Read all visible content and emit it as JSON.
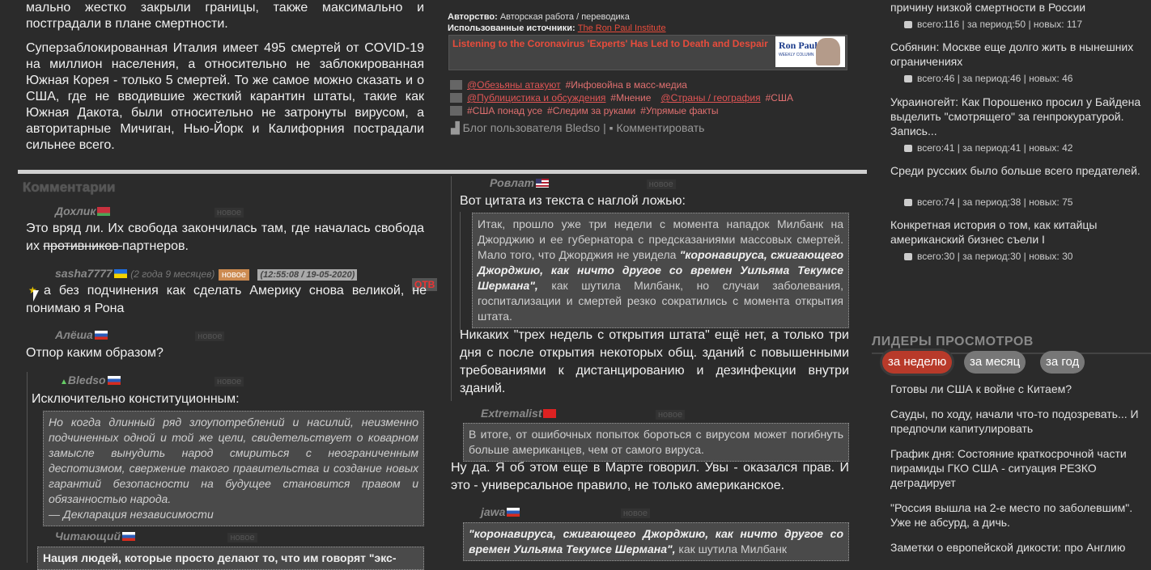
{
  "article": {
    "p1": "мально жестко закрыли границы, также максимально и постградали в плане смертности.",
    "p2": "Суперзаблокированная Италия имеет 495 смертей от COVID-19 на миллион населения, а относительно не заблокированная Южная Корея - только 5 смертей. То же самое можно сказать и о США, где не вводившие жесткий карантин штаты, такие как Южная Дакота, были относительно не затронуты вирусом, а авторитарные Мичиган, Нью-Йорк и Калифорния пострадали сильнее всего."
  },
  "meta": {
    "author_label": "Авторство:",
    "author_value": "Авторская работа / переводика",
    "sources_label": "Использованные источники:",
    "sources_value": "The Ron Paul Institute",
    "card_title": "Listening to the Coronavirus 'Experts' Has Led to Death and Despair",
    "card_thumb_name": "Ron Paul",
    "card_thumb_sub": "WEEKLY COLUMN"
  },
  "tags": {
    "r1a": "@Обезьяны атакуют",
    "r1b": "#Инфовойна в масс-медиа",
    "r2a": "@Публицистика и обсуждения",
    "r2b": "#Мнение",
    "r2c": "@Страны / география",
    "r2d": "#США",
    "r3a": "#США понад усе",
    "r3b": "#Следим за руками",
    "r3c": "#Упрямые факты"
  },
  "bloglinks": {
    "blog": "Блог пользователя Bledso",
    "sep": "|",
    "comment": "Комментировать"
  },
  "comments_title": "Комментарии",
  "new_label": "новое",
  "left_comments": {
    "c1_user": "Дохлик",
    "c1_text_a": "Это вряд ли. Их свобода закончилась там, где началась свобода их ",
    "c1_text_strike": "противников ",
    "c1_text_b": "партнеров.",
    "c2_user": "sasha7777",
    "c2_ago": "(2 года 9 месяцев)",
    "c2_time": "(12:55:08 / 19-05-2020)",
    "c2_otv": "ОТВ",
    "c2_text": "а без подчинения как сделать Америку снова великой, не понимаю я Рона",
    "c3_user": "Алёша",
    "c3_text": "Отпор каким образом?",
    "c4_user": "Bledso",
    "c4_text": "Исключительно конституционным:",
    "c4_quote": "Но когда длинный ряд злоупотреблений и насилий, неизменно подчиненных одной и той же цели, свидетельствует о коварном замысле вынудить народ смириться с неограниченным деспотизмом, свержение такого правительства и создание новых гарантий безопасности на будущее становится правом и обязанностью народа.",
    "c4_quote_src": "— Декларация независимости",
    "c5_user": "Читающий",
    "c5_quote": "Нация людей, которые просто делают то, что им говорят \"экс-"
  },
  "right_comments": {
    "c1_user": "Ровлат",
    "c1_text": "Вот цитата из текста с наглой ложью:",
    "c1_quote_a": "Итак, прошло уже три недели с момента нападок Милбанк на Джорджию и ее губернатора с предсказаниями массовых смертей. Мало того, что Джорджия не увидела ",
    "c1_quote_b": "\"коронавируса, сжигающего Джорджию, как ничто другое со времен Уильяма Текумсе Шермана\",",
    "c1_quote_c": " как шутила Милбанк, но случаи заболевания, госпитализации и смертей резко сократились с момента открытия штата.",
    "c1_text2": "Никаких \"трех недель с открытия штата\" ещё нет, а только три дня с после открытия некоторых общ. зданий с повышенными требованиями к дистанцированию и дезинфекции внутри зданий.",
    "c2_user": "Extremalist",
    "c2_quote": "В итоге, от ошибочных попыток бороться с вирусом может погибнуть больше американцев, чем от самого вируса.",
    "c2_text": "Ну да. Я об этом еще в Марте говорил. Увы - оказался прав. И это - универсальное правило, не только американское.",
    "c3_user": "jawa",
    "c3_quote_b": "\"коронавируса, сжигающего Джорджию, как ничто другое со времен Уильяма Текумсе Шермана\",",
    "c3_quote_c": " как шутила Милбанк"
  },
  "sidebar": {
    "i0": "причину низкой смертности в России",
    "i0_stats": "всего:116 | за период:50 | новых: 117",
    "i1": "Собянин: Москве еще долго жить в нынешних ограничениях",
    "i1_stats": "всего:46 | за период:46 | новых: 46",
    "i2": "Украиногейт: Как Порошенко просил у Байдена выделить \"смотрящего\" за генпрокуратурой. Запись...",
    "i2_stats": "всего:41 | за период:41 | новых: 42",
    "i3": "Среди русских было больше всего предателей.",
    "i3_stats": "всего:74 | за период:38 | новых: 75",
    "i4": "Конкретная история о том, как китайцы американский бизнес съели I",
    "i4_stats": "всего:30 | за период:30 | новых: 30"
  },
  "leaders": {
    "title": "ЛИДЕРЫ ПРОСМОТРОВ",
    "tab_week": "за неделю",
    "tab_month": "за месяц",
    "tab_year": "за год",
    "items": [
      "Готовы ли США к войне с Китаем?",
      "Сауды, по ходу, начали что-то подозревать... И предпочли капитулировать",
      "График дня: Состояние краткосрочной части пирамиды ГКО США - ситуация РЕЗКО деградирует",
      "\"Россия вышла на 2-е место по заболевшим\". Уже не абсурд, а дичь.",
      "Заметки о европейской дикости: про Англию"
    ]
  },
  "colors": {
    "accent": "#b83a2a",
    "link": "#e74c3c",
    "background": "#2b2b2b"
  }
}
